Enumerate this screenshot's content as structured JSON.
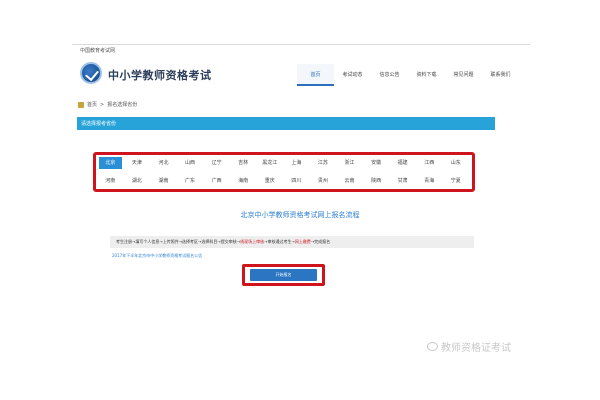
{
  "browser": {
    "tab_title": "中国教育考试网"
  },
  "header": {
    "site_title": "中小学教师资格考试",
    "nav": [
      "首页",
      "考试动态",
      "信息公告",
      "资料下载",
      "常见问题",
      "联系我们"
    ],
    "active_nav": 0
  },
  "breadcrumb": {
    "home": "首页",
    "separator": ">",
    "current": "报名选择省份"
  },
  "section": {
    "title": "请选择报考省份"
  },
  "regions": {
    "row1": [
      "北京",
      "天津",
      "河北",
      "山西",
      "辽宁",
      "吉林",
      "黑龙江",
      "上海",
      "江苏",
      "浙江",
      "安徽",
      "福建",
      "江西",
      "山东"
    ],
    "row2": [
      "河南",
      "湖北",
      "湖南",
      "广东",
      "广西",
      "海南",
      "重庆",
      "四川",
      "贵州",
      "云南",
      "陕西",
      "甘肃",
      "青海",
      "宁夏"
    ],
    "active": "北京"
  },
  "process": {
    "title": "北京中小学教师资格考试网上报名流程",
    "steps_before": "考生注册→填写个人信息→上传照件→选择考区→选择科目→提交审核→",
    "highlight1": "线现场上审核",
    "steps_middle": "→审核通过考生→",
    "highlight2": "网上缴费",
    "steps_after": "→完成报名"
  },
  "notice": {
    "link_text": "2017年下半年北京市中小学教师资格考试报名公告"
  },
  "action": {
    "button_label": "开始报名"
  },
  "watermark": {
    "text": "教师资格证考试"
  },
  "colors": {
    "accent_blue": "#27a3d9",
    "highlight_red": "#d0141d",
    "button_blue": "#2b75c2"
  }
}
